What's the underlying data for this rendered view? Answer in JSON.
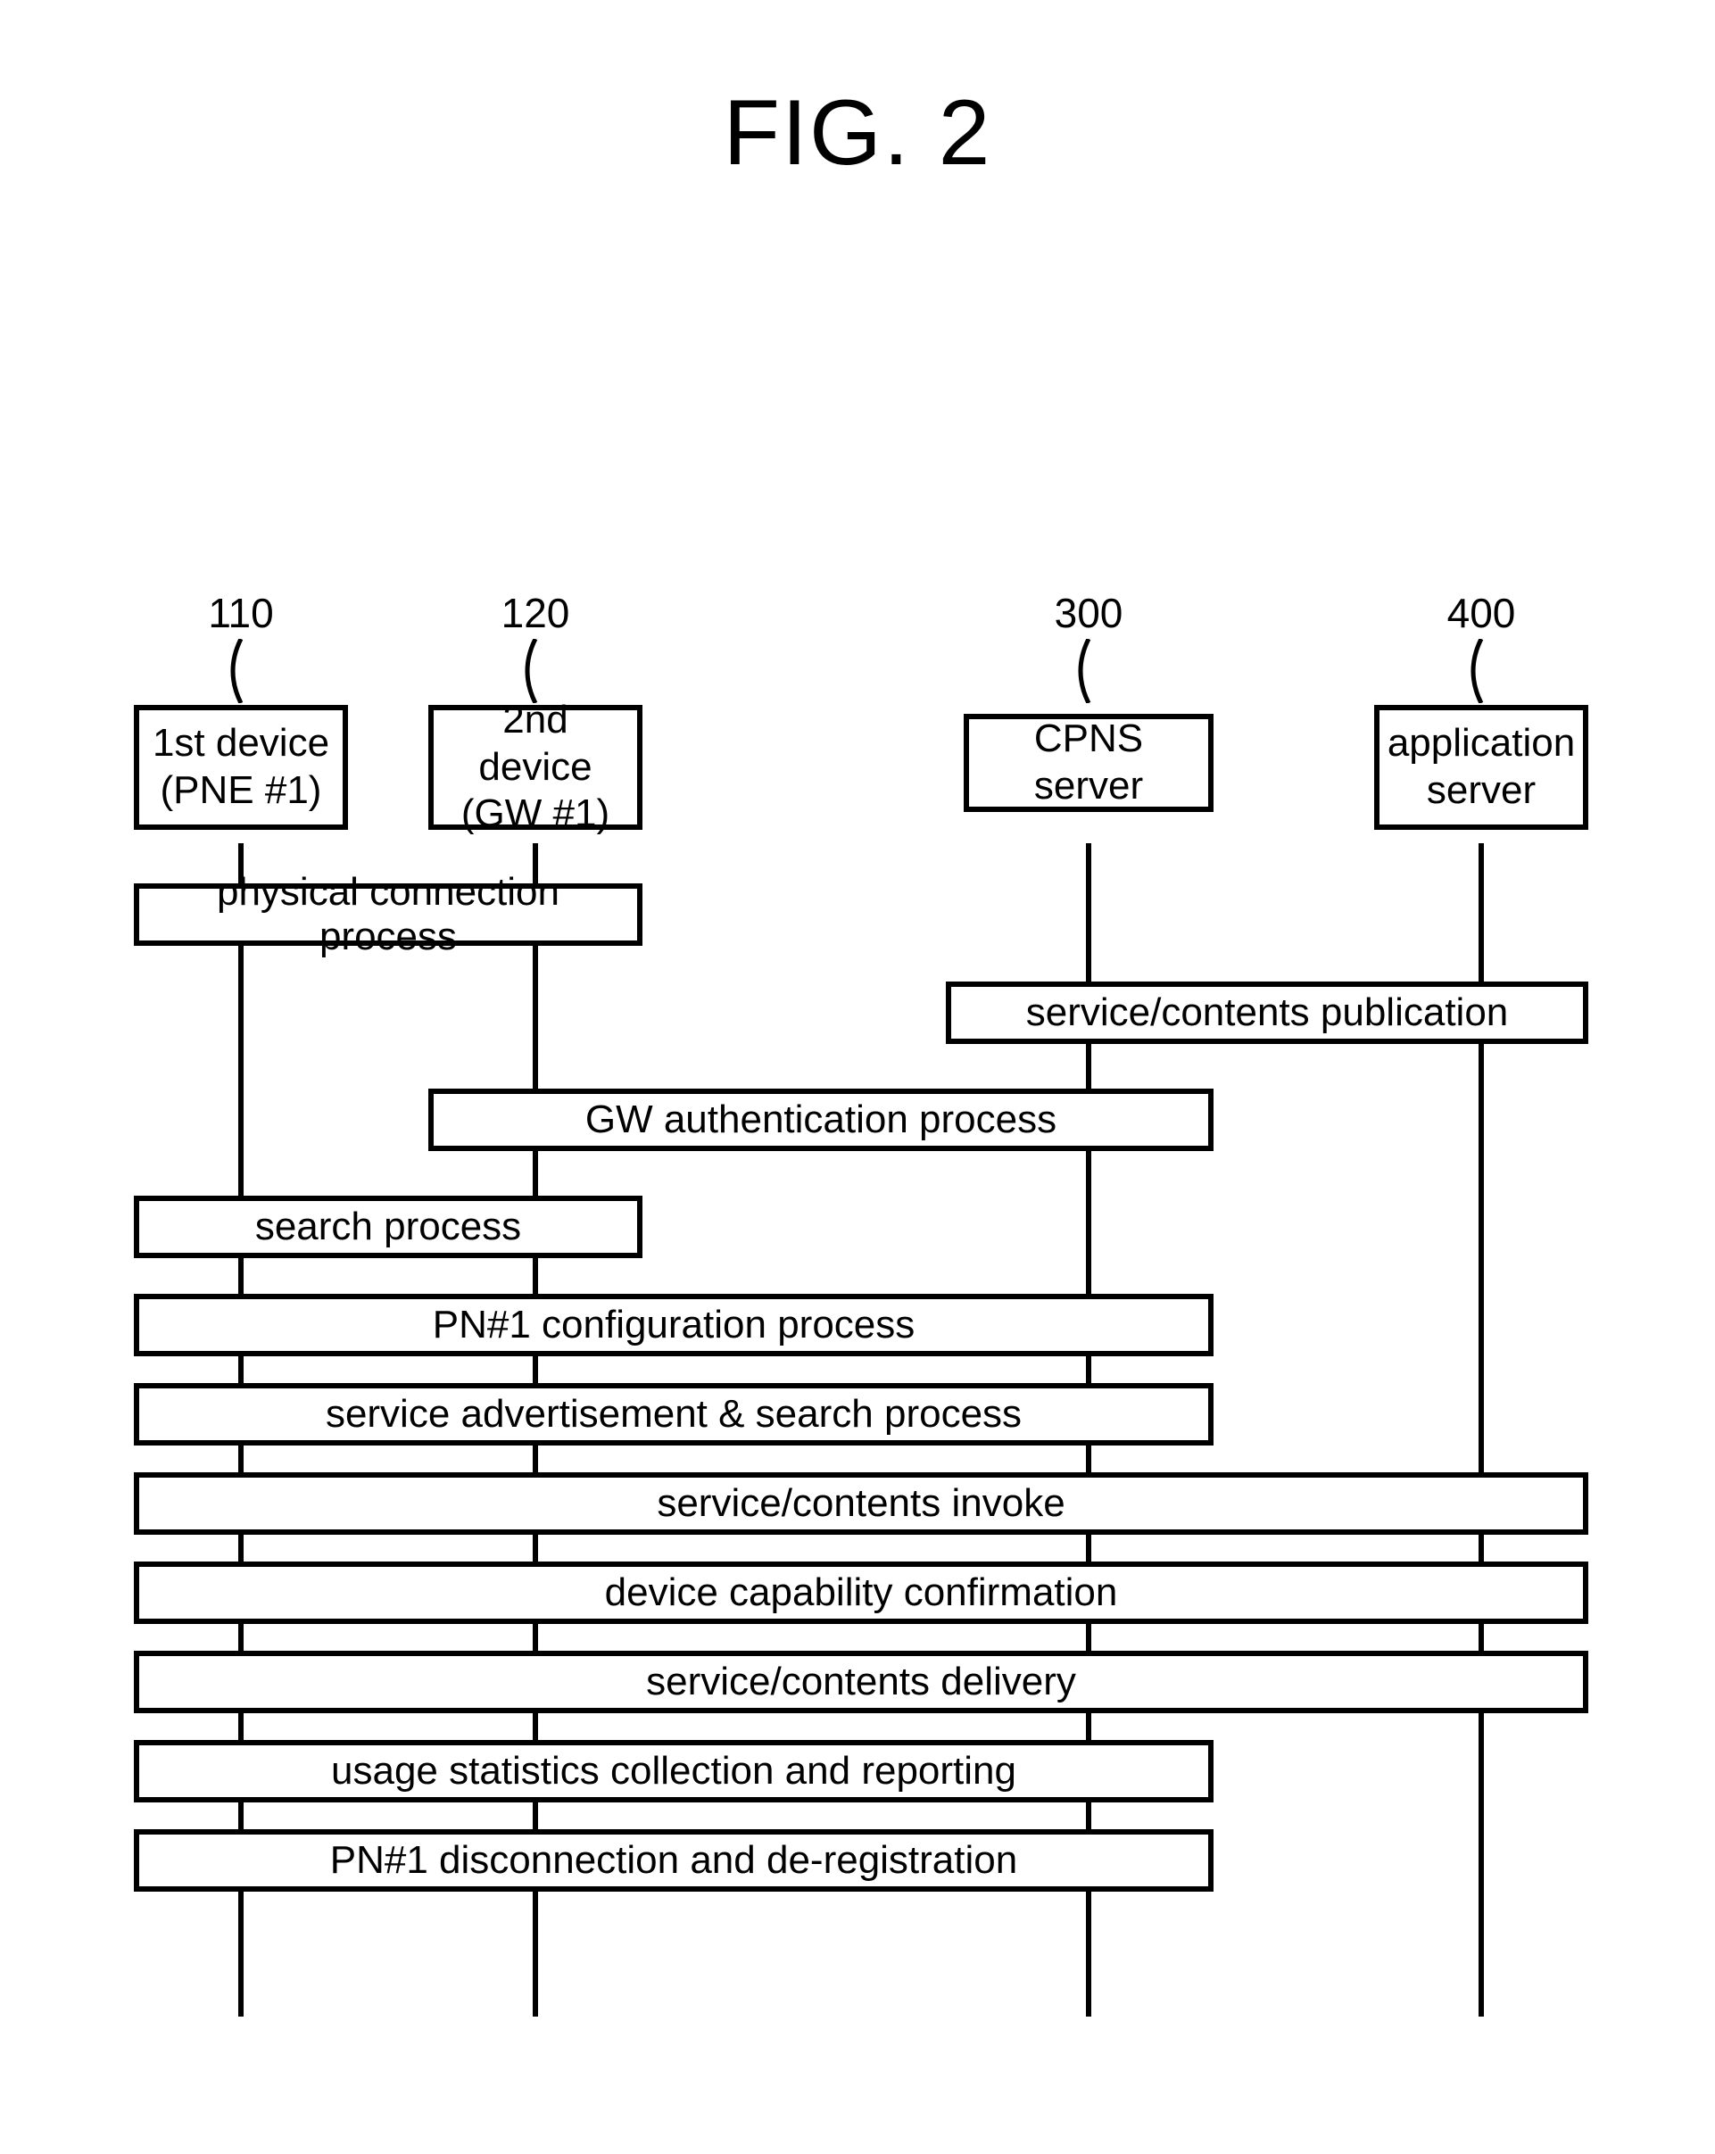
{
  "title": "FIG. 2",
  "actors": {
    "a1": {
      "ref": "110",
      "line1": "1st device",
      "line2": "(PNE #1)"
    },
    "a2": {
      "ref": "120",
      "line1": "2nd device",
      "line2": "(GW #1)"
    },
    "a3": {
      "ref": "300",
      "label": "CPNS server"
    },
    "a4": {
      "ref": "400",
      "line1": "application",
      "line2": "server"
    }
  },
  "steps": {
    "s1": "physical connection process",
    "s2": "service/contents publication",
    "s3": "GW authentication process",
    "s4": "search process",
    "s5": "PN#1 configuration process",
    "s6": "service advertisement & search process",
    "s7": "service/contents invoke",
    "s8": "device capability confirmation",
    "s9": "service/contents delivery",
    "s10": "usage statistics collection and reporting",
    "s11": "PN#1 disconnection and de-registration"
  }
}
